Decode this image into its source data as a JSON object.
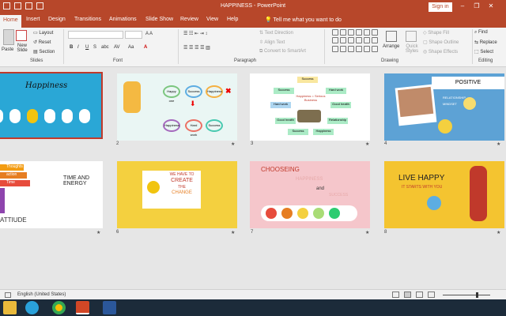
{
  "window": {
    "title": "HAPPINESS - PowerPoint",
    "signin": "Sign in",
    "minimize": "–",
    "restore": "❐",
    "close": "✕"
  },
  "tabs": [
    "Home",
    "Insert",
    "Design",
    "Transitions",
    "Animations",
    "Slide Show",
    "Review",
    "View",
    "Help"
  ],
  "tell_me": "Tell me what you want to do",
  "ribbon": {
    "paste": "Paste",
    "new_slide": "New Slide",
    "layout": "Layout",
    "reset": "Reset",
    "section": "Section",
    "slides_group": "Slides",
    "font_group": "Font",
    "paragraph_group": "Paragraph",
    "text_direction": "Text Direction",
    "align_text": "Align Text",
    "convert_smartart": "Convert to SmartArt",
    "drawing_group": "Drawing",
    "arrange": "Arrange",
    "quick_styles": "Quick Styles",
    "shape_fill": "Shape Fill",
    "shape_outline": "Shape Outline",
    "shape_effects": "Shape Effects",
    "find": "Find",
    "replace": "Replace",
    "select": "Select",
    "editing_group": "Editing",
    "bold": "B",
    "italic": "I",
    "underline": "U",
    "strike": "S",
    "shadow": "abc",
    "spacing": "AV",
    "case": "Aa",
    "font_color": "A"
  },
  "slides": [
    {
      "num": "1",
      "title": "Happiness"
    },
    {
      "num": "2",
      "labels": [
        "Happy one",
        "Success",
        "Happiness",
        "Happiness",
        "Hard work",
        "Success"
      ]
    },
    {
      "num": "3",
      "center": "Happiness = Serious Business",
      "labels": [
        "Success",
        "Success",
        "Hard work",
        "Hard work",
        "Good health",
        "Good health",
        "Relationship",
        "Success",
        "Happiness"
      ]
    },
    {
      "num": "4",
      "positive": "POSITIVE",
      "relationship": "RELATIONSHIP",
      "mindset": "MINDSET"
    },
    {
      "num": "5",
      "attitude": "ATTIUDE",
      "thoughts": "Thoughts",
      "action": "action",
      "time": "Time",
      "time_energy": "TIME AND ENERGY"
    },
    {
      "num": "6",
      "line1": "WE HAVE TO",
      "line2": "CREATE",
      "line3": "THE",
      "line4": "CHANGE"
    },
    {
      "num": "7",
      "choosing": "CHOOSEING",
      "happiness": "HAPPINESS",
      "and": "and",
      "success": "SUCCESS"
    },
    {
      "num": "8",
      "live": "LIVE HAPPY",
      "sub": "IT STARTS WITH YOU"
    }
  ],
  "status": {
    "language": "English (United States)"
  },
  "colors": {
    "accent": "#b7472a",
    "ribbon": "#f3f3f3",
    "canvas": "#e6e6e6"
  }
}
